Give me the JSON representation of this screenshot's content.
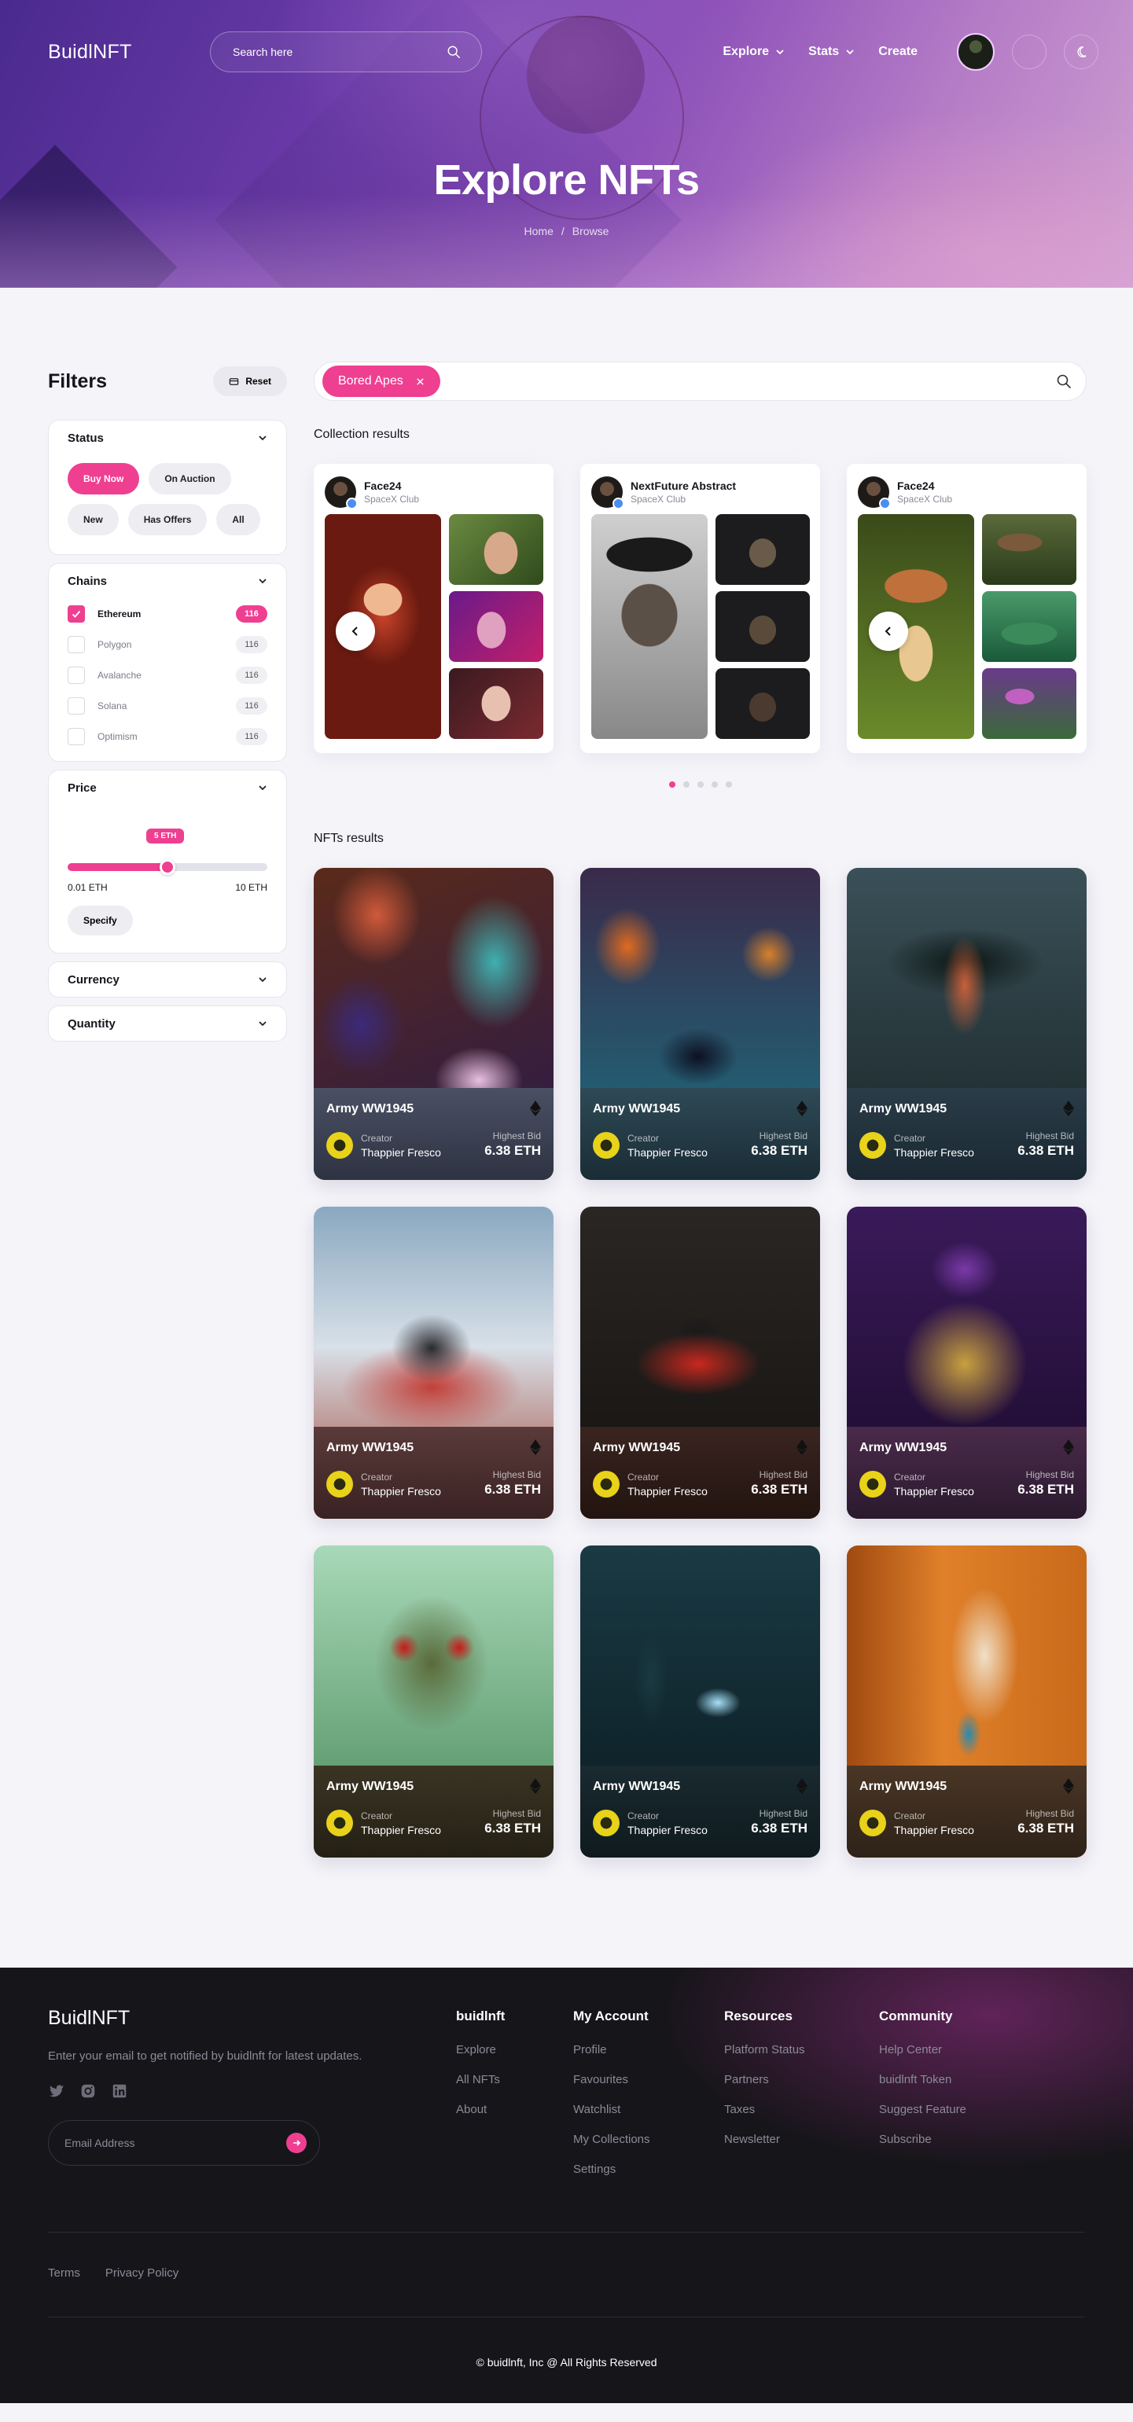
{
  "brand": "BuidlNFT",
  "header": {
    "search_placeholder": "Search here",
    "menu": {
      "explore": "Explore",
      "stats": "Stats",
      "create": "Create"
    }
  },
  "hero": {
    "title": "Explore NFTs",
    "breadcrumb": {
      "home": "Home",
      "sep": "/",
      "current": "Browse"
    }
  },
  "filters": {
    "title": "Filters",
    "reset_label": "Reset",
    "status": {
      "label": "Status",
      "tags": [
        "Buy Now",
        "On Auction",
        "New",
        "Has Offers",
        "All"
      ],
      "active": "Buy Now"
    },
    "chains": {
      "label": "Chains",
      "items": [
        {
          "name": "Ethereum",
          "count": "116",
          "checked": true
        },
        {
          "name": "Polygon",
          "count": "116",
          "checked": false
        },
        {
          "name": "Avalanche",
          "count": "116",
          "checked": false
        },
        {
          "name": "Solana",
          "count": "116",
          "checked": false
        },
        {
          "name": "Optimism",
          "count": "116",
          "checked": false
        }
      ]
    },
    "price": {
      "label": "Price",
      "bubble": "5 ETH",
      "min_label": "0.01 ETH",
      "max_label": "10 ETH",
      "value_fraction": 0.5,
      "specify_label": "Specify"
    },
    "currency_label": "Currency",
    "quantity_label": "Quantity"
  },
  "search_chip": "Bored Apes",
  "collections": {
    "label": "Collection results",
    "items": [
      {
        "name": "Face24",
        "sub": "SpaceX Club"
      },
      {
        "name": "NextFuture Abstract",
        "sub": "SpaceX Club"
      },
      {
        "name": "Face24",
        "sub": "SpaceX Club"
      }
    ],
    "pages": 5,
    "active_page": 0
  },
  "nfts": {
    "label": "NFTs results",
    "creator_label": "Creator",
    "bid_label": "Highest Bid",
    "items": [
      {
        "title": "Army WW1945",
        "creator": "Thappier Fresco",
        "bid": "6.38 ETH"
      },
      {
        "title": "Army WW1945",
        "creator": "Thappier Fresco",
        "bid": "6.38 ETH"
      },
      {
        "title": "Army WW1945",
        "creator": "Thappier Fresco",
        "bid": "6.38 ETH"
      },
      {
        "title": "Army WW1945",
        "creator": "Thappier Fresco",
        "bid": "6.38 ETH"
      },
      {
        "title": "Army WW1945",
        "creator": "Thappier Fresco",
        "bid": "6.38 ETH"
      },
      {
        "title": "Army WW1945",
        "creator": "Thappier Fresco",
        "bid": "6.38 ETH"
      },
      {
        "title": "Army WW1945",
        "creator": "Thappier Fresco",
        "bid": "6.38 ETH"
      },
      {
        "title": "Army WW1945",
        "creator": "Thappier Fresco",
        "bid": "6.38 ETH"
      },
      {
        "title": "Army WW1945",
        "creator": "Thappier Fresco",
        "bid": "6.38 ETH"
      }
    ]
  },
  "footer": {
    "brand": "BuidlNFT",
    "tagline": "Enter your email to get notified by buidlnft for latest updates.",
    "email_placeholder": "Email Address",
    "columns": [
      {
        "title": "buidlnft",
        "links": [
          "Explore",
          "All NFTs",
          "About"
        ]
      },
      {
        "title": "My Account",
        "links": [
          "Profile",
          "Favourites",
          "Watchlist",
          "My Collections",
          "Settings"
        ]
      },
      {
        "title": "Resources",
        "links": [
          "Platform Status",
          "Partners",
          "Taxes",
          "Newsletter"
        ]
      },
      {
        "title": "Community",
        "links": [
          "Help Center",
          "buidlnft Token",
          "Suggest Feature",
          "Subscribe"
        ]
      }
    ],
    "legal": [
      "Terms",
      "Privacy Policy"
    ],
    "copyright": "© buidlnft, Inc @ All Rights Reserved"
  },
  "colors": {
    "accent": "#ef3f91",
    "footer_bg": "#161519",
    "verify": "#4a8ef0"
  },
  "icons": [
    "search-icon",
    "chevron-down-icon",
    "moon-icon",
    "reset-icon",
    "close-icon",
    "check-icon",
    "chevron-left-icon",
    "ethereum-icon",
    "twitter-icon",
    "instagram-icon",
    "linkedin-icon",
    "arrow-right-icon"
  ]
}
